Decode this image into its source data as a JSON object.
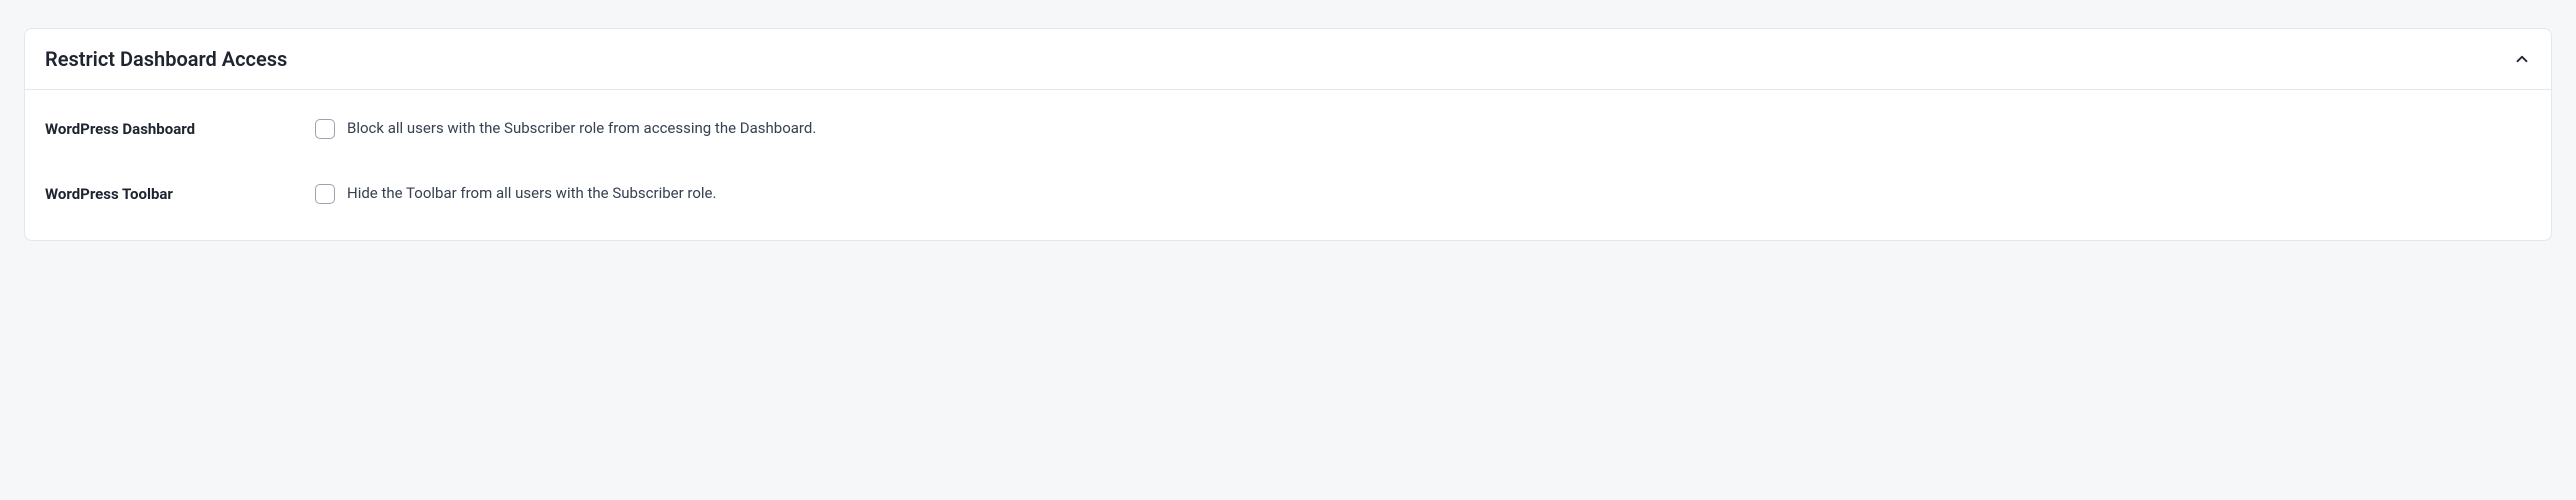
{
  "panel": {
    "title": "Restrict Dashboard Access",
    "fields": [
      {
        "label": "WordPress Dashboard",
        "description": "Block all users with the Subscriber role from accessing the Dashboard."
      },
      {
        "label": "WordPress Toolbar",
        "description": "Hide the Toolbar from all users with the Subscriber role."
      }
    ]
  }
}
